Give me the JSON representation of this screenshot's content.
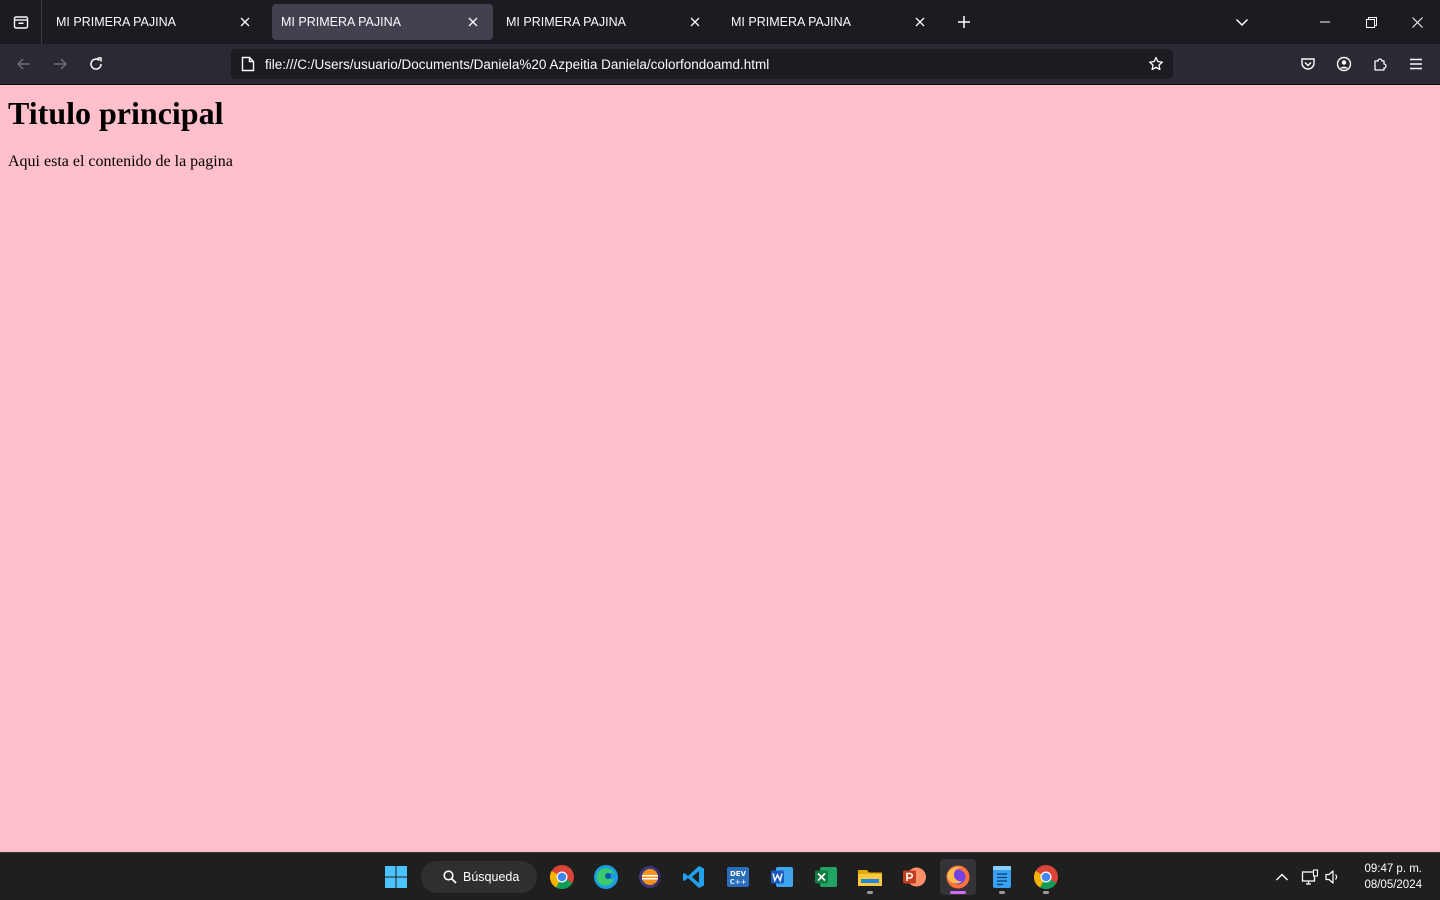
{
  "browser": {
    "tabs": [
      {
        "title": "MI PRIMERA PAJINA",
        "active": false
      },
      {
        "title": "MI PRIMERA PAJINA",
        "active": true
      },
      {
        "title": "MI PRIMERA PAJINA",
        "active": false
      },
      {
        "title": "MI PRIMERA PAJINA",
        "active": false
      }
    ],
    "url": "file:///C:/Users/usuario/Documents/Daniela%20 Azpeitia Daniela/colorfondoamd.html"
  },
  "page": {
    "background_color": "#ffc0cb",
    "heading": "Titulo principal",
    "paragraph": "Aqui esta el contenido de la pagina"
  },
  "taskbar": {
    "search_label": "Búsqueda",
    "apps": [
      "chrome-icon",
      "edge-icon",
      "eclipse-icon",
      "vscode-icon",
      "devc-icon",
      "word-icon",
      "excel-icon",
      "file-explorer-icon",
      "powerpoint-icon",
      "firefox-icon",
      "notepad-icon",
      "chrome-icon"
    ],
    "time": "09:47 p. m.",
    "date": "08/05/2024"
  },
  "colors": {
    "tabstrip_bg": "#1c1b22",
    "toolbar_bg": "#2b2a33",
    "active_tab_bg": "#42414d",
    "taskbar_bg": "#1f1f1f",
    "firefox_indicator": "#d36cf5"
  }
}
